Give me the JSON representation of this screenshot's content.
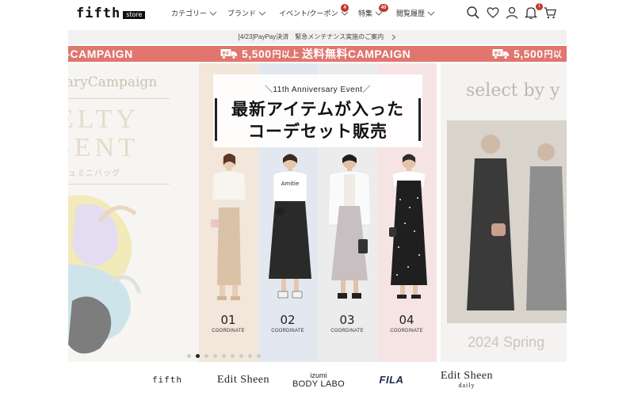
{
  "header": {
    "logo_text": "fifth",
    "logo_badge": "store",
    "nav": [
      {
        "label": "カテゴリー",
        "badge": ""
      },
      {
        "label": "ブランド",
        "badge": ""
      },
      {
        "label": "イベント/クーポン",
        "badge": "4"
      },
      {
        "label": "特集",
        "badge": "40"
      },
      {
        "label": "閲覧履歴",
        "badge": ""
      }
    ],
    "icons": [
      "search-icon",
      "heart-icon",
      "user-icon",
      "bell-icon",
      "cart-icon"
    ],
    "bell_badge": "1"
  },
  "notice": {
    "text": "[4/23]PayPay決済　緊急メンテナンス実施のご案内"
  },
  "ticker": {
    "left_fragment": "料CAMPAIGN",
    "item_amount": "5,500",
    "item_yen": "円以上",
    "item_text": "送料無料CAMPAIGN",
    "right_amount": "5,500",
    "right_yen": "円以",
    "truck_label": "¥0"
  },
  "carousel": {
    "left_slide": {
      "line1": "rsaryCampaign",
      "line2": "ELTY",
      "line3": "SENT",
      "line4": "ュミニバッグ"
    },
    "main_slide": {
      "event_caption": "＼11th Anniversary Event／",
      "headline_line1": "最新アイテムが入った",
      "headline_line2": "コーデセット販売",
      "coordinates": [
        {
          "number": "01",
          "label": "COORDINATE"
        },
        {
          "number": "02",
          "label": "COORDINATE"
        },
        {
          "number": "03",
          "label": "COORDINATE"
        },
        {
          "number": "04",
          "label": "COORDINATE"
        }
      ],
      "model_tshirt_text": "Amitie"
    },
    "right_slide": {
      "title": "select by y",
      "subtitle": "2024 Spring"
    },
    "dot_count": 9,
    "active_dot": 1
  },
  "brands": {
    "fifth": "fifth",
    "edit_sheen": "Edit Sheen",
    "izumi_line1": "izumi",
    "izumi_line2": "BODY LABO",
    "fila": "FILA",
    "edit_sheen_daily_line1": "Edit Sheen",
    "edit_sheen_daily_line2": "daily"
  },
  "colors": {
    "campaign_red": "#e0766e",
    "badge_red": "#c0392b",
    "notice_bg": "#f1f1f1"
  }
}
